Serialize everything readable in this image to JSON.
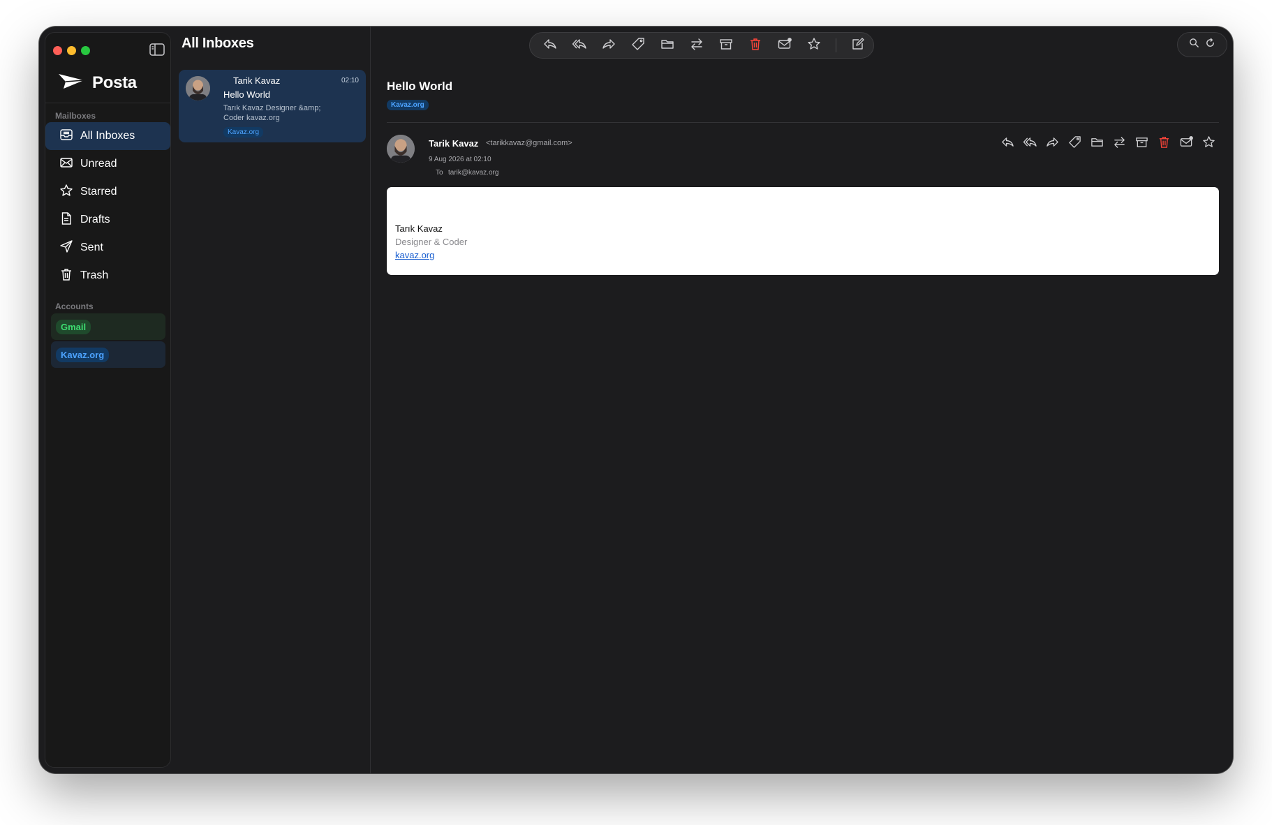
{
  "app": {
    "name": "Posta",
    "traffic_lights": [
      "#ff5f57",
      "#febc2e",
      "#28c840"
    ],
    "accent": "#4da3ff",
    "selection_bg": "#1d3350"
  },
  "sidebar": {
    "mailboxes_title": "Mailboxes",
    "items": [
      {
        "label": "All Inboxes",
        "icon": "inbox-icon",
        "active": true
      },
      {
        "label": "Unread",
        "icon": "envelope-icon"
      },
      {
        "label": "Starred",
        "icon": "star-icon"
      },
      {
        "label": "Drafts",
        "icon": "document-icon"
      },
      {
        "label": "Sent",
        "icon": "paper-plane-icon"
      },
      {
        "label": "Trash",
        "icon": "trash-icon"
      }
    ],
    "accounts_title": "Accounts",
    "accounts": [
      {
        "label": "Gmail",
        "color": "#3ddc70",
        "bg": "#1f3a26"
      },
      {
        "label": "Kavaz.org",
        "color": "#4da3ff",
        "bg": "#123a63"
      }
    ]
  },
  "list": {
    "title": "All Inboxes",
    "messages": [
      {
        "sender": "Tarik Kavaz",
        "time": "02:10",
        "subject": "Hello World",
        "preview": "Tarık Kavaz Designer &amp; Coder kavaz.org",
        "tag": "Kavaz.org"
      }
    ]
  },
  "toolbar": {
    "actions": [
      "reply-icon",
      "reply-all-icon",
      "forward-icon",
      "tag-icon",
      "folder-icon",
      "move-icon",
      "archive-icon",
      "trash-icon",
      "mark-unread-icon",
      "star-icon",
      "compose-icon"
    ],
    "danger_color": "#ff453a"
  },
  "message": {
    "subject": "Hello World",
    "tag": "Kavaz.org",
    "sender_name": "Tarik Kavaz",
    "sender_email": "<tarikkavaz@gmail.com>",
    "date": "9 Aug 2026 at 02:10",
    "to_label": "To",
    "to": "tarik@kavaz.org",
    "body": {
      "name": "Tarık Kavaz",
      "title": "Designer & Coder",
      "link": "kavaz.org"
    }
  }
}
